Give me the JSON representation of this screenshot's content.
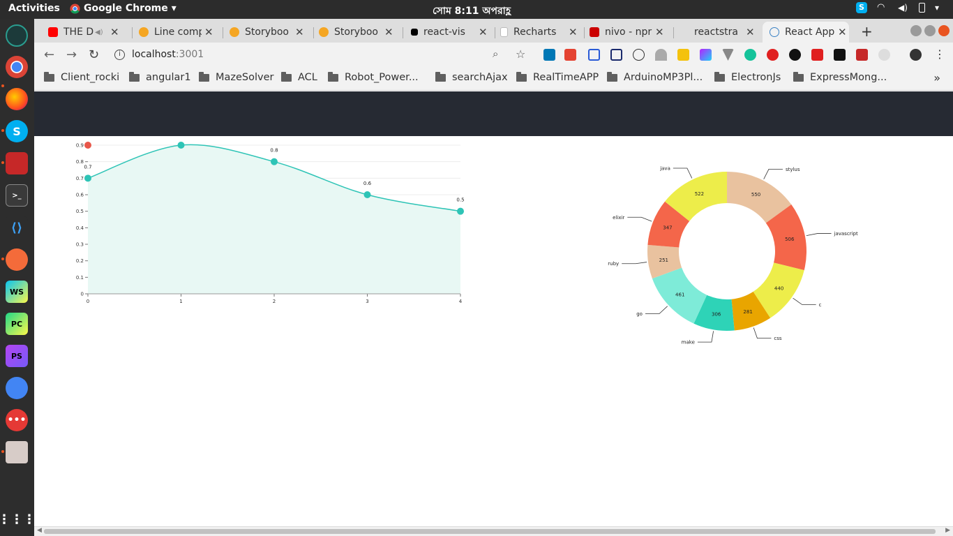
{
  "topbar": {
    "activities": "Activities",
    "app_name": "Google Chrome",
    "clock": "সোম  8:11 অপরাহ্ণ"
  },
  "tabs": [
    {
      "title": "THE D",
      "favicon_color": "#ff0000",
      "favicon": "youtube-icon"
    },
    {
      "title": "Line comp",
      "favicon_color": "#f5a623",
      "favicon": "storybook-icon"
    },
    {
      "title": "Storyboo",
      "favicon_color": "#f5a623",
      "favicon": "storybook-icon"
    },
    {
      "title": "Storyboo",
      "favicon_color": "#f5a623",
      "favicon": "storybook-icon"
    },
    {
      "title": "react-vis",
      "favicon_color": "#000000",
      "favicon": "react-vis-icon"
    },
    {
      "title": "Recharts",
      "favicon_color": "#cccccc",
      "favicon": "page-icon"
    },
    {
      "title": "nivo - npr",
      "favicon_color": "#cb0000",
      "favicon": "npm-icon"
    },
    {
      "title": "reactstra",
      "favicon_color": "#dddddd",
      "favicon": "page-icon"
    },
    {
      "title": "React App",
      "favicon_color": "#61dafb",
      "favicon": "react-icon",
      "active": true
    }
  ],
  "toolbar": {
    "url_host": "localhost",
    "url_port": ":3001"
  },
  "bookmarks": [
    "Client_rocki",
    "angular1",
    "MazeSolver",
    "ACL",
    "Robot_Power...",
    "searchAjax",
    "RealTimeAPP",
    "ArduinoMP3Pl...",
    "ElectronJs",
    "ExpressMong..."
  ],
  "colors": {
    "header_bg": "#262a33",
    "line_stroke": "#2ec4b6",
    "area_fill": "#e8f8f4",
    "highlight_point": "#e8574a"
  },
  "chart_data": [
    {
      "type": "area",
      "x": [
        0,
        1,
        2,
        3,
        4
      ],
      "values": [
        0.7,
        0.9,
        0.8,
        0.6,
        0.5
      ],
      "point_labels": [
        "0.7",
        "",
        "0.8",
        "0.6",
        "0.5"
      ],
      "highlight_point": {
        "x": 0,
        "y": 0.9
      },
      "xticks": [
        "0",
        "1",
        "2",
        "3",
        "4"
      ],
      "yticks": [
        "0",
        "0.1",
        "0.2",
        "0.3",
        "0.4",
        "0.5",
        "0.6",
        "0.7",
        "0.8",
        "0.9"
      ],
      "ylim": [
        0,
        0.9
      ],
      "xlim": [
        0,
        4
      ],
      "grid": true,
      "curve": "smooth"
    },
    {
      "type": "pie",
      "variant": "donut",
      "slices": [
        {
          "label": "stylus",
          "value": 550,
          "color": "#e9c29f"
        },
        {
          "label": "javascript",
          "value": 506,
          "color": "#f4664a"
        },
        {
          "label": "c",
          "value": 440,
          "color": "#eded4a"
        },
        {
          "label": "css",
          "value": 281,
          "color": "#e9a500"
        },
        {
          "label": "make",
          "value": 306,
          "color": "#2ed3b7"
        },
        {
          "label": "go",
          "value": 461,
          "color": "#7eebd8"
        },
        {
          "label": "ruby",
          "value": 251,
          "color": "#e9c29f"
        },
        {
          "label": "elixir",
          "value": 347,
          "color": "#f4664a"
        },
        {
          "label": "java",
          "value": 522,
          "color": "#eded4a"
        }
      ]
    }
  ]
}
